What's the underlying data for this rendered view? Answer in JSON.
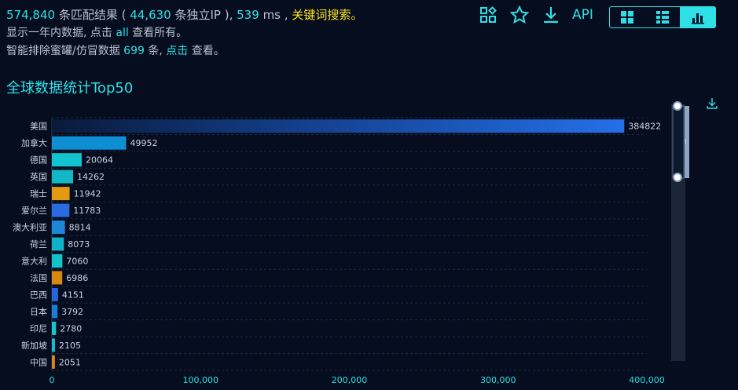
{
  "summary": {
    "match_count": "574,840",
    "match_label": "条匹配结果 (",
    "ip_count": "44,630",
    "ip_label": "条独立IP ),",
    "time": "539",
    "time_unit": "ms ,",
    "keyword_link": "关键词搜索。",
    "line2_a": "显示一年内数据, 点击",
    "line2_link": "all",
    "line2_b": "查看所有。",
    "line3_a": "智能排除蜜罐/仿冒数据",
    "line3_count": "699",
    "line3_b": "条,",
    "line3_link": "点击",
    "line3_c": "查看。"
  },
  "toolbar": {
    "icons": [
      "grid-add-icon",
      "star-icon",
      "download-icon"
    ],
    "api_label": "API",
    "views": [
      "grid-view-icon",
      "list-view-icon",
      "bar-chart-view-icon"
    ],
    "active_view": 2
  },
  "chart_title": "全球数据统计Top50",
  "chart_data": {
    "type": "bar",
    "orientation": "horizontal",
    "title": "全球数据统计Top50",
    "categories": [
      "美国",
      "加拿大",
      "德国",
      "英国",
      "瑞士",
      "爱尔兰",
      "澳大利亚",
      "荷兰",
      "意大利",
      "法国",
      "巴西",
      "日本",
      "印尼",
      "新加坡",
      "中国"
    ],
    "values": [
      384822,
      49952,
      20064,
      14262,
      11942,
      11783,
      8814,
      8073,
      7060,
      6986,
      4151,
      3792,
      2780,
      2105,
      2051
    ],
    "value_labels": [
      "384822",
      "49952",
      "20064",
      "14262",
      "11942",
      "11783",
      "8814",
      "8073",
      "7060",
      "6986",
      "4151",
      "3792",
      "2780",
      "2105",
      "2051"
    ],
    "xlim": [
      0,
      400000
    ],
    "xticks": [
      0,
      100000,
      200000,
      300000,
      400000
    ],
    "xtick_labels": [
      "0",
      "100,000",
      "200,000",
      "300,000",
      "400,000"
    ],
    "bar_colors": [
      "#1f6fe0",
      "#0e8fd4",
      "#12c4cf",
      "#14b8c4",
      "#e39a12",
      "#2a6be0",
      "#1d86d8",
      "#12b0c8",
      "#14c2cc",
      "#d88a10",
      "#2466e0",
      "#1a7fd2",
      "#14c6d0",
      "#16bcd0",
      "#d88a10"
    ],
    "grid": true
  },
  "colors": {
    "accent": "#2ee0e6",
    "keyword": "#ffe21f",
    "background": "#050d1f"
  }
}
